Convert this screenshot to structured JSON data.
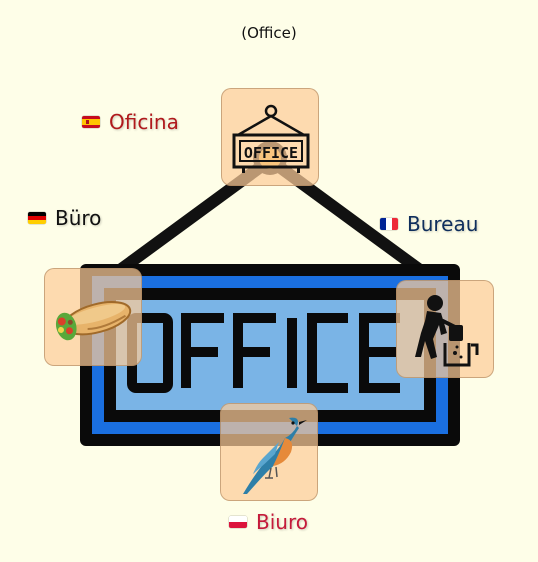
{
  "caption": "(Office)",
  "center_icon": "office-sign-icon",
  "hint_tiles": [
    {
      "icon": "office-sign-icon"
    },
    {
      "icon": "burrito-icon"
    },
    {
      "icon": "cleaner-icon"
    },
    {
      "icon": "bird-icon"
    }
  ],
  "translations": {
    "spanish": {
      "label": "Oficina",
      "flag": "flag-es-icon",
      "color": "#b0191c"
    },
    "german": {
      "label": "Büro",
      "flag": "flag-de-icon",
      "color": "#111111"
    },
    "french": {
      "label": "Bureau",
      "flag": "flag-fr-icon",
      "color": "#0e2e5c"
    },
    "polish": {
      "label": "Biuro",
      "flag": "flag-pl-icon",
      "color": "#c51a3a"
    }
  },
  "colors": {
    "background": "#fefee8",
    "tile": "#fccc98",
    "sign_blue": "#1a6fe0",
    "sign_light": "#7ab4e6",
    "sign_dark": "#0a0a0a"
  }
}
